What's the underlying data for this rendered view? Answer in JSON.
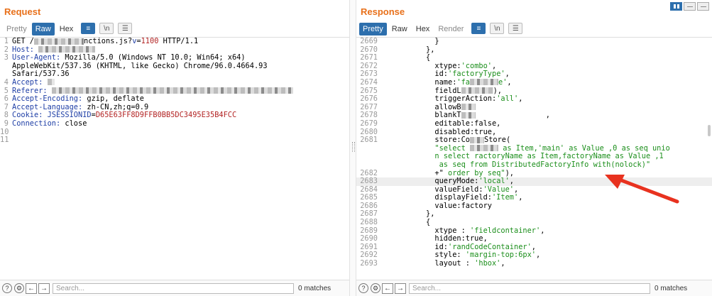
{
  "request": {
    "title": "Request",
    "tabs": [
      "Pretty",
      "Raw",
      "Hex"
    ],
    "active_tab": "Raw",
    "tool_newline": "\\n",
    "search_placeholder": "Search...",
    "matches": "0 matches",
    "lines": [
      {
        "n": "1",
        "segs": [
          {
            "t": "GET /",
            "c": "h"
          },
          {
            "blur": 70
          },
          {
            "t": "nctions.js?",
            "c": "h"
          },
          {
            "t": "v",
            "c": "k"
          },
          {
            "t": "=",
            "c": "h"
          },
          {
            "t": "1100",
            "c": "cv"
          },
          {
            "t": " HTTP/1.1",
            "c": "h"
          }
        ]
      },
      {
        "n": "2",
        "segs": [
          {
            "t": "Host: ",
            "c": "ck"
          },
          {
            "blur": 80
          }
        ]
      },
      {
        "n": "3",
        "segs": [
          {
            "t": "User-Agent: ",
            "c": "ck"
          },
          {
            "t": "Mozilla/5.0 (Windows NT 10.0; Win64; x64)",
            "c": "h"
          }
        ]
      },
      {
        "n": "",
        "segs": [
          {
            "t": "AppleWebKit/537.36 (KHTML, like Gecko) Chrome/96.0.4664.93",
            "c": "h"
          }
        ]
      },
      {
        "n": "",
        "segs": [
          {
            "t": "Safari/537.36",
            "c": "h"
          }
        ]
      },
      {
        "n": "4",
        "segs": [
          {
            "t": "Accept: ",
            "c": "ck"
          },
          {
            "blur": 10
          }
        ]
      },
      {
        "n": "5",
        "segs": [
          {
            "t": "Referer: ",
            "c": "ck"
          },
          {
            "blur": 340
          }
        ]
      },
      {
        "n": "6",
        "segs": [
          {
            "t": "Accept-Encoding: ",
            "c": "ck"
          },
          {
            "t": "gzip, deflate",
            "c": "h"
          }
        ]
      },
      {
        "n": "7",
        "segs": [
          {
            "t": "Accept-Language: ",
            "c": "ck"
          },
          {
            "t": "zh-CN,zh;q=0.9",
            "c": "h"
          }
        ]
      },
      {
        "n": "8",
        "segs": [
          {
            "t": "Cookie: ",
            "c": "ck"
          },
          {
            "t": "JSESSIONID",
            "c": "ck"
          },
          {
            "t": "=",
            "c": "h"
          },
          {
            "t": "D65E63FF8D9FFB0BB5DC3495E35B4FCC",
            "c": "cv"
          }
        ]
      },
      {
        "n": "9",
        "segs": [
          {
            "t": "Connection: ",
            "c": "ck"
          },
          {
            "t": "close",
            "c": "h"
          }
        ]
      },
      {
        "n": "10",
        "segs": []
      },
      {
        "n": "11",
        "segs": []
      }
    ]
  },
  "response": {
    "title": "Response",
    "tabs": [
      "Pretty",
      "Raw",
      "Hex",
      "Render"
    ],
    "active_tab": "Pretty",
    "tool_newline": "\\n",
    "search_placeholder": "Search...",
    "matches": "0 matches",
    "lines": [
      {
        "n": "2669",
        "segs": [
          {
            "t": "            }",
            "c": "h"
          }
        ]
      },
      {
        "n": "2670",
        "segs": [
          {
            "t": "          },",
            "c": "h"
          }
        ]
      },
      {
        "n": "2671",
        "segs": [
          {
            "t": "          {",
            "c": "h"
          }
        ]
      },
      {
        "n": "2672",
        "segs": [
          {
            "t": "            xtype:",
            "c": "h"
          },
          {
            "t": "'combo'",
            "c": "s"
          },
          {
            "t": ",",
            "c": "h"
          }
        ]
      },
      {
        "n": "2673",
        "segs": [
          {
            "t": "            id:",
            "c": "h"
          },
          {
            "t": "'factoryType'",
            "c": "s"
          },
          {
            "t": ",",
            "c": "h"
          }
        ]
      },
      {
        "n": "2674",
        "segs": [
          {
            "t": "            name:",
            "c": "h"
          },
          {
            "t": "'fa",
            "c": "s"
          },
          {
            "blur": 40
          },
          {
            "t": "e'",
            "c": "s"
          },
          {
            "t": ",",
            "c": "h"
          }
        ]
      },
      {
        "n": "2675",
        "segs": [
          {
            "t": "            fieldL",
            "c": "h"
          },
          {
            "blur": 45
          },
          {
            "t": "),",
            "c": "h"
          }
        ]
      },
      {
        "n": "2676",
        "segs": [
          {
            "t": "            triggerAction:",
            "c": "h"
          },
          {
            "t": "'all'",
            "c": "s"
          },
          {
            "t": ",",
            "c": "h"
          }
        ]
      },
      {
        "n": "2677",
        "segs": [
          {
            "t": "            allowB",
            "c": "h"
          },
          {
            "blur": 20
          }
        ]
      },
      {
        "n": "2678",
        "segs": [
          {
            "t": "            blankT",
            "c": "h"
          },
          {
            "blur": 20
          },
          {
            "t": "                ,",
            "c": "h"
          }
        ]
      },
      {
        "n": "2679",
        "segs": [
          {
            "t": "            editable:false,",
            "c": "h"
          }
        ]
      },
      {
        "n": "2680",
        "segs": [
          {
            "t": "            disabled:true,",
            "c": "h"
          }
        ]
      },
      {
        "n": "2681",
        "segs": [
          {
            "t": "            store:Co",
            "c": "h"
          },
          {
            "blur": 20
          },
          {
            "t": "Store(",
            "c": "h"
          }
        ]
      },
      {
        "n": "",
        "segs": [
          {
            "t": "            \"select ",
            "c": "s"
          },
          {
            "blur": 40
          },
          {
            "t": " as Item,'main' as Value ,0 as seq unio",
            "c": "s"
          }
        ]
      },
      {
        "n": "",
        "segs": [
          {
            "t": "            n select ractoryName as Item,factoryName as Value ,1",
            "c": "s"
          }
        ]
      },
      {
        "n": "",
        "segs": [
          {
            "t": "             as seq from DistributedFactoryInfo with(nolock)\"",
            "c": "s"
          }
        ]
      },
      {
        "n": "2682",
        "segs": [
          {
            "t": "            +\"",
            "c": "h"
          },
          {
            "t": " order by seq\"",
            "c": "s"
          },
          {
            "t": "),",
            "c": "h"
          }
        ]
      },
      {
        "n": "2683",
        "hl": true,
        "segs": [
          {
            "t": "            queryMode:",
            "c": "h"
          },
          {
            "t": "'local'",
            "c": "s"
          },
          {
            "t": ",",
            "c": "h"
          }
        ]
      },
      {
        "n": "2684",
        "segs": [
          {
            "t": "            valueField:",
            "c": "h"
          },
          {
            "t": "'Value'",
            "c": "s"
          },
          {
            "t": ",",
            "c": "h"
          }
        ]
      },
      {
        "n": "2685",
        "segs": [
          {
            "t": "            displayField:",
            "c": "h"
          },
          {
            "t": "'Item'",
            "c": "s"
          },
          {
            "t": ",",
            "c": "h"
          }
        ]
      },
      {
        "n": "2686",
        "segs": [
          {
            "t": "            value:factory",
            "c": "h"
          }
        ]
      },
      {
        "n": "2687",
        "segs": [
          {
            "t": "          },",
            "c": "h"
          }
        ]
      },
      {
        "n": "2688",
        "segs": [
          {
            "t": "          {",
            "c": "h"
          }
        ]
      },
      {
        "n": "2689",
        "segs": [
          {
            "t": "            xtype : ",
            "c": "h"
          },
          {
            "t": "'fieldcontainer'",
            "c": "s"
          },
          {
            "t": ",",
            "c": "h"
          }
        ]
      },
      {
        "n": "2690",
        "segs": [
          {
            "t": "            hidden:true,",
            "c": "h"
          }
        ]
      },
      {
        "n": "2691",
        "segs": [
          {
            "t": "            id:",
            "c": "h"
          },
          {
            "t": "'randCodeContainer'",
            "c": "s"
          },
          {
            "t": ",",
            "c": "h"
          }
        ]
      },
      {
        "n": "2692",
        "segs": [
          {
            "t": "            style: ",
            "c": "h"
          },
          {
            "t": "'margin-top:6px'",
            "c": "s"
          },
          {
            "t": ",",
            "c": "h"
          }
        ]
      },
      {
        "n": "2693",
        "segs": [
          {
            "t": "            layout : ",
            "c": "h"
          },
          {
            "t": "'hbox'",
            "c": "s"
          },
          {
            "t": ",",
            "c": "h"
          }
        ]
      }
    ]
  },
  "colors": {
    "accent": "#e8701a",
    "active_tab": "#2d6fad",
    "string": "#1c8f1c",
    "header_key": "#1f3fa6",
    "value_red": "#b22222",
    "arrow": "#e8321f"
  }
}
